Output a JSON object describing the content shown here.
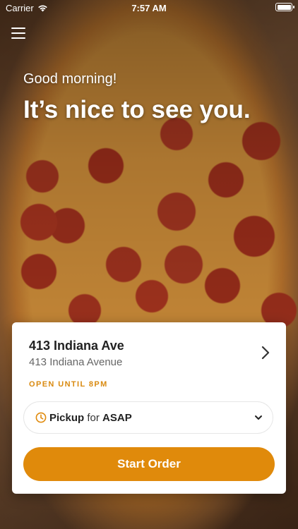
{
  "status_bar": {
    "carrier": "Carrier",
    "time": "7:57 AM"
  },
  "header": {
    "greeting": "Good morning!",
    "headline": "It’s nice to see you."
  },
  "store": {
    "name": "413 Indiana Ave",
    "address": "413 Indiana Avenue",
    "open_status": "OPEN UNTIL 8PM"
  },
  "order_mode": {
    "mode": "Pickup",
    "connector": "for",
    "time": "ASAP"
  },
  "actions": {
    "start_order": "Start Order"
  },
  "colors": {
    "accent": "#E08A0B",
    "status_text": "#D98A10"
  },
  "icons": [
    "wifi-icon",
    "battery-icon",
    "menu-icon",
    "chevron-right-icon",
    "clock-icon",
    "chevron-down-icon"
  ]
}
